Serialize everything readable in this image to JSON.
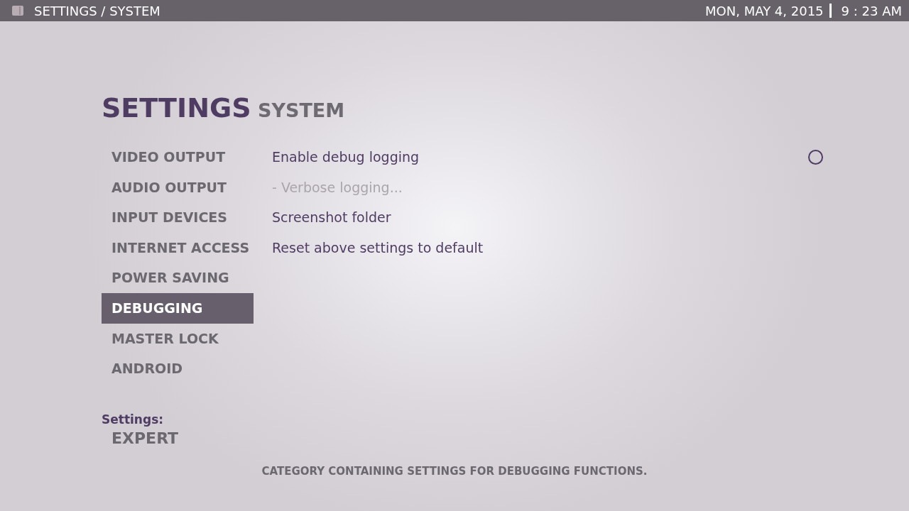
{
  "top_bar": {
    "title": "SETTINGS / SYSTEM",
    "date": "MON, MAY 4, 2015",
    "time": "9 : 23 AM"
  },
  "heading": {
    "title": "SETTINGS",
    "section": "SYSTEM"
  },
  "categories": [
    {
      "label": "VIDEO OUTPUT",
      "selected": false
    },
    {
      "label": "AUDIO OUTPUT",
      "selected": false
    },
    {
      "label": "INPUT DEVICES",
      "selected": false
    },
    {
      "label": "INTERNET ACCESS",
      "selected": false
    },
    {
      "label": "POWER SAVING",
      "selected": false
    },
    {
      "label": "DEBUGGING",
      "selected": true
    },
    {
      "label": "MASTER LOCK",
      "selected": false
    },
    {
      "label": "ANDROID",
      "selected": false
    }
  ],
  "options": [
    {
      "kind": "toggle",
      "label": "Enable debug logging",
      "disabled": false,
      "checked": false
    },
    {
      "kind": "action",
      "label": "- Verbose logging...",
      "disabled": true
    },
    {
      "kind": "action",
      "label": "Screenshot folder",
      "disabled": false
    },
    {
      "kind": "action",
      "label": "Reset above settings to default",
      "disabled": false
    }
  ],
  "settings_level": {
    "label": "Settings:",
    "value": "EXPERT"
  },
  "description": "CATEGORY CONTAINING SETTINGS FOR DEBUGGING FUNCTIONS."
}
